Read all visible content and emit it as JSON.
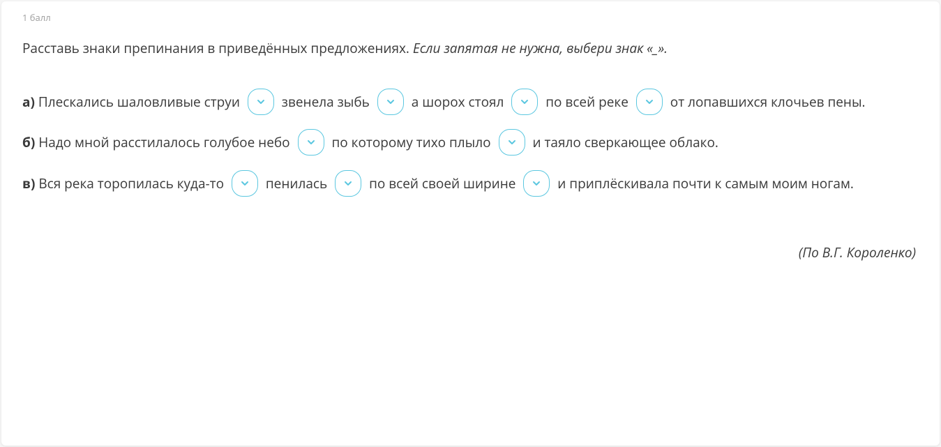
{
  "score": "1 балл",
  "instruction": {
    "main": "Расставь знаки препинания в приведённых предложениях. ",
    "hint": "Если запятая не нужна, выбери знак «_»."
  },
  "sentences": {
    "a": {
      "label": "а)",
      "p1": " Плескались шаловливые струи ",
      "p2": " звенела зыбь ",
      "p3": " а шорох стоял ",
      "p4": " по всей реке ",
      "p5": " от лопавшихся клочьев пены."
    },
    "b": {
      "label": "б)",
      "p1": " Надо мной расстилалось голубое небо ",
      "p2": " по которому тихо плыло ",
      "p3": " и таяло сверкающее облако."
    },
    "c": {
      "label": "в)",
      "p1": " Вся река торопилась куда-то ",
      "p2": " пенилась ",
      "p3": " по всей своей ширине ",
      "p4": " и приплёскивала почти к самым моим ногам."
    }
  },
  "attribution": "(По В.Г. Короленко)"
}
